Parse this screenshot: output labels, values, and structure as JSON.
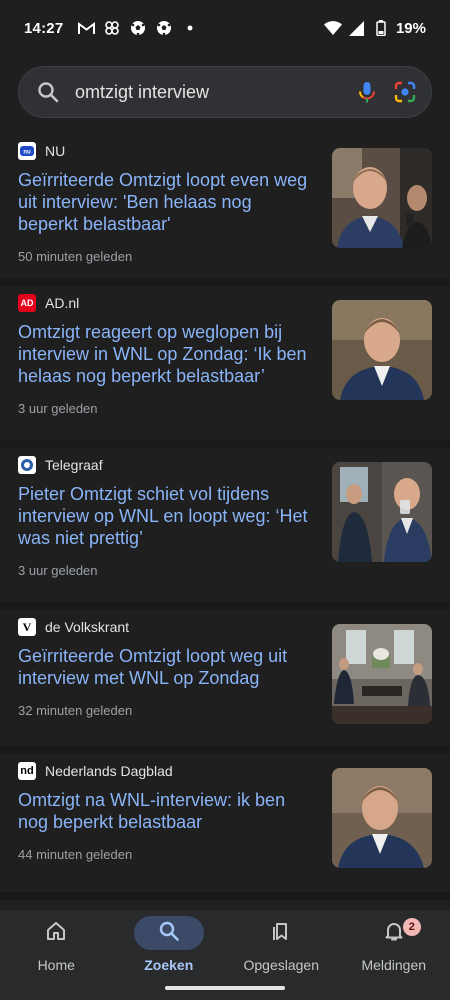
{
  "status_bar": {
    "time": "14:27",
    "battery": "19%",
    "notification_icons": [
      "gmail-icon",
      "pinwheel-icon",
      "soccer-ball-icon",
      "soccer-ball-icon",
      "dot-icon"
    ]
  },
  "search": {
    "query": "omtzigt interview",
    "placeholder": "omtzigt interview"
  },
  "results": [
    {
      "source": "NU",
      "headline": "Geïrriteerde Omtzigt loopt even weg uit interview: 'Ben helaas nog beperkt belastbaar'",
      "time": "50 minuten geleden"
    },
    {
      "source": "AD.nl",
      "favicon_text": "AD",
      "headline": "Omtzigt reageert op weglopen bij interview in WNL op Zondag: ‘Ik ben helaas nog beperkt belastbaar’",
      "time": "3 uur geleden"
    },
    {
      "source": "Telegraaf",
      "headline": "Pieter Omtzigt schiet vol tijdens interview op WNL en loopt weg: ‘Het was niet prettig’",
      "time": "3 uur geleden"
    },
    {
      "source": "de Volkskrant",
      "favicon_text": "V",
      "headline": "Geïrriteerde Omtzigt loopt weg uit interview met WNL op Zondag",
      "time": "32 minuten geleden"
    },
    {
      "source": "Nederlands Dagblad",
      "favicon_text": "nd",
      "headline": "Omtzigt na WNL-interview: ik ben nog beperkt belastbaar",
      "time": "44 minuten geleden"
    }
  ],
  "bottom_nav": {
    "items": [
      {
        "label": "Home",
        "icon": "home-icon"
      },
      {
        "label": "Zoeken",
        "icon": "search-icon",
        "active": true
      },
      {
        "label": "Opgeslagen",
        "icon": "bookmark-icon"
      },
      {
        "label": "Meldingen",
        "icon": "bell-icon",
        "badge": "2"
      }
    ]
  },
  "colors": {
    "background": "#1f1f1f",
    "link": "#8ab4f8",
    "active_nav": "#a8c7fa",
    "badge": "#f2b8b5"
  }
}
